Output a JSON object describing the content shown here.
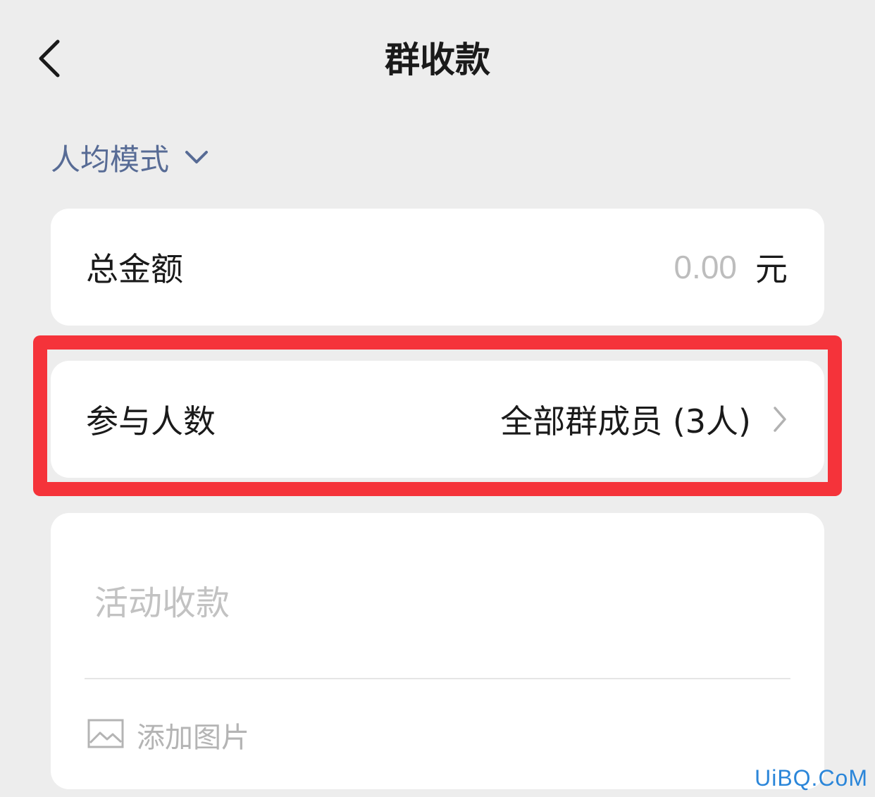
{
  "header": {
    "title": "群收款",
    "back_icon": "chevron-left-icon"
  },
  "mode": {
    "label": "人均模式",
    "icon": "chevron-down-icon"
  },
  "amount": {
    "label": "总金额",
    "placeholder": "0.00",
    "unit": "元"
  },
  "participants": {
    "label": "参与人数",
    "value": "全部群成员 (3人)",
    "icon": "chevron-right-icon",
    "highlight_color": "#f5333a"
  },
  "note": {
    "placeholder": "活动收款",
    "add_image_label": "添加图片",
    "add_image_icon": "image-icon"
  },
  "watermark": "UiBQ.CoM",
  "colors": {
    "background": "#ededed",
    "link": "#576b95",
    "placeholder": "#bdbdbd",
    "card": "#ffffff"
  }
}
